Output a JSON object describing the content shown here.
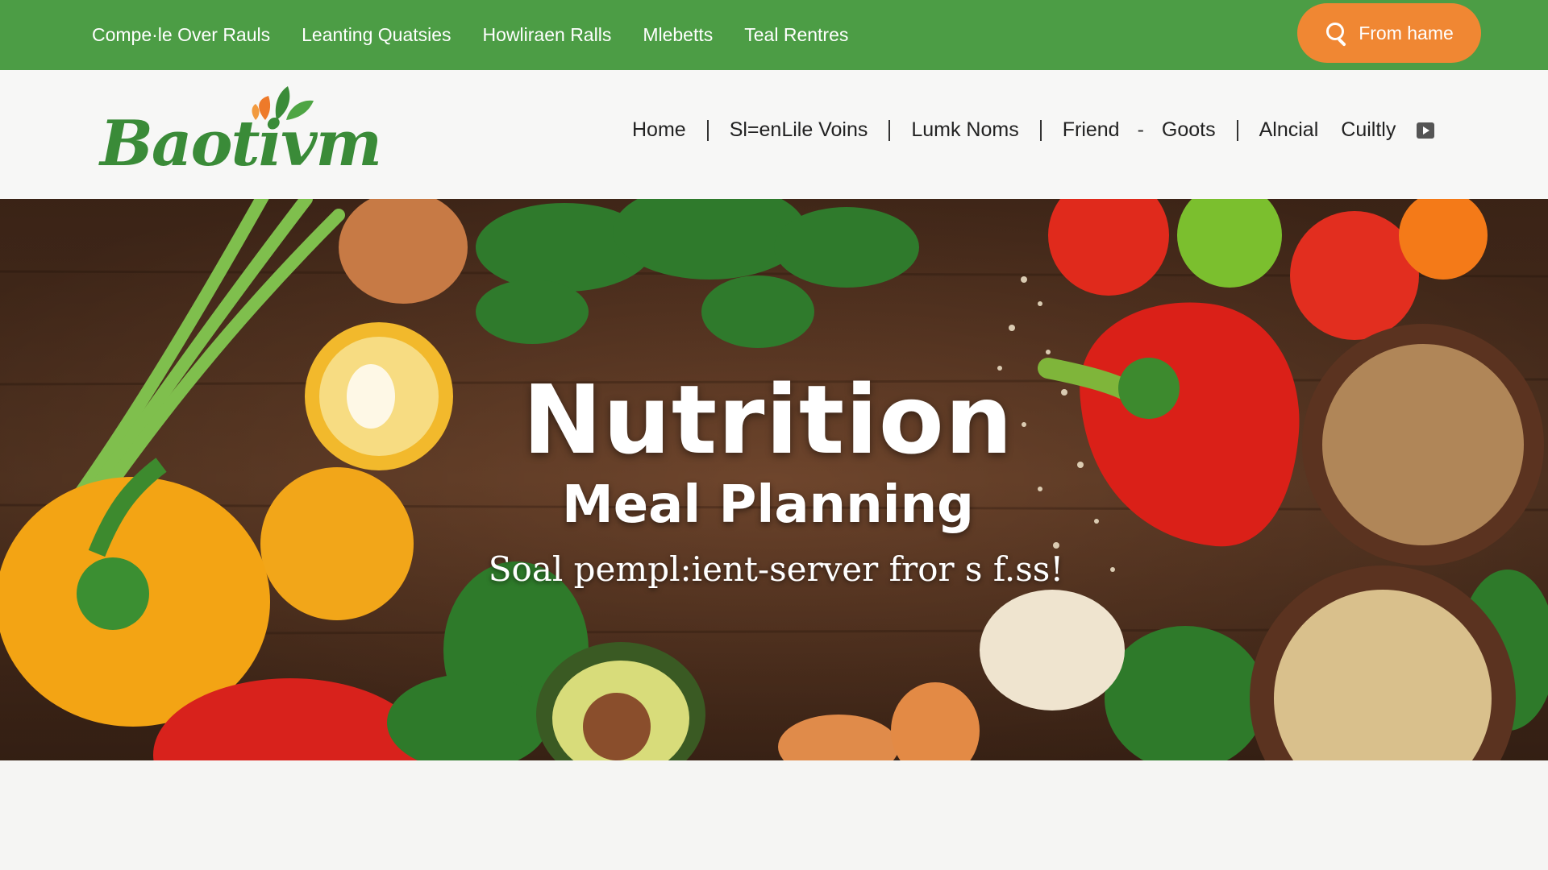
{
  "topbar": {
    "links": [
      "Compe·le Over Rauls",
      "Leanting Quatsies",
      "Howliraen Ralls",
      "Mlebetts",
      "Teal Rentres"
    ],
    "cta": {
      "label": "From hame",
      "icon": "search-icon"
    }
  },
  "header": {
    "logo_text": "Baotivm",
    "nav": {
      "home": "Home",
      "item2": "Sl=enLile Voins",
      "item3": "Lumk Noms",
      "item4": "Friend",
      "dash": "-",
      "item5": "Goots",
      "item6": "Alncial",
      "item7": "Cuiltly",
      "media_icon": "play-icon"
    }
  },
  "hero": {
    "title": "Nutrition",
    "subtitle": "Meal Planning",
    "tagline": "Soal pempl:ient-server fror s f.ss!"
  },
  "colors": {
    "topbar_green": "#4c9d45",
    "cta_orange": "#f08733",
    "logo_green": "#3a8b38",
    "logo_leaf_orange": "#ee7a2a",
    "wood_brown": "#6b4128"
  }
}
